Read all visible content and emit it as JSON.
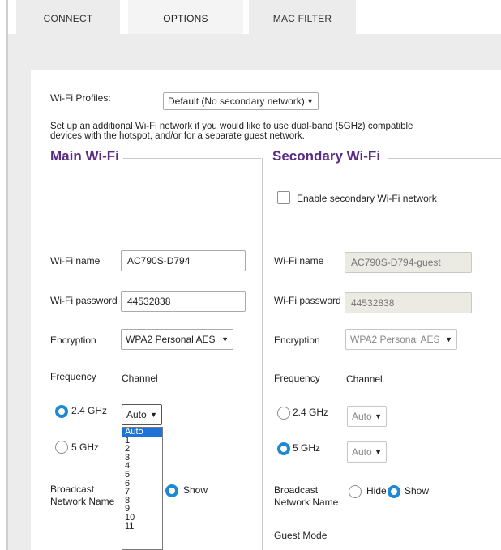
{
  "tabs": [
    {
      "label": "CONNECT",
      "active": false
    },
    {
      "label": "OPTIONS",
      "active": true
    },
    {
      "label": "MAC FILTER",
      "active": false
    }
  ],
  "profiles": {
    "label": "Wi-Fi Profiles:",
    "value": "Default (No secondary network)"
  },
  "description": {
    "line1": "Set up an additional Wi-Fi network if you would like to use dual-band (5GHz) compatible",
    "line2": "devices with the hotspot, and/or for a separate guest network."
  },
  "main": {
    "title": "Main Wi-Fi",
    "wifi_name_label": "Wi-Fi name",
    "wifi_name_value": "AC790S-D794",
    "wifi_password_label": "Wi-Fi password",
    "wifi_password_value": "44532838",
    "encryption_label": "Encryption",
    "encryption_value": "WPA2 Personal AES",
    "frequency_label": "Frequency",
    "channel_label": "Channel",
    "freq_24_label": "2.4 GHz",
    "freq_5_label": "5 GHz",
    "freq_selected": "2.4 GHz",
    "channel_value": "Auto",
    "broadcast_label_line1": "Broadcast",
    "broadcast_label_line2": "Network Name",
    "show_label": "Show",
    "broadcast_selected": "Show"
  },
  "channel_dropdown": {
    "options": [
      "Auto",
      "1",
      "2",
      "3",
      "4",
      "5",
      "6",
      "7",
      "8",
      "9",
      "10",
      "11"
    ],
    "highlighted": "Auto"
  },
  "secondary": {
    "title": "Secondary Wi-Fi",
    "enable_label": "Enable secondary Wi-Fi network",
    "enabled": false,
    "wifi_name_label": "Wi-Fi name",
    "wifi_name_value": "AC790S-D794-guest",
    "wifi_password_label": "Wi-Fi password",
    "wifi_password_value": "44532838",
    "encryption_label": "Encryption",
    "encryption_value": "WPA2 Personal AES",
    "frequency_label": "Frequency",
    "channel_label": "Channel",
    "freq_24_label": "2.4 GHz",
    "freq_5_label": "5 GHz",
    "freq_selected": "5 GHz",
    "channel_24_value": "Auto",
    "channel_5_value": "Auto",
    "broadcast_label_line1": "Broadcast",
    "broadcast_label_line2": "Network Name",
    "hide_label": "Hide",
    "show_label": "Show",
    "broadcast_selected": "Show",
    "guest_mode_label": "Guest Mode"
  },
  "colors": {
    "accent": "#5b2c83",
    "radio_selected": "#1e88d4",
    "dropdown_highlight": "#1e73d9"
  },
  "icons": {
    "select_arrow": "dropdown-arrow-icon"
  }
}
